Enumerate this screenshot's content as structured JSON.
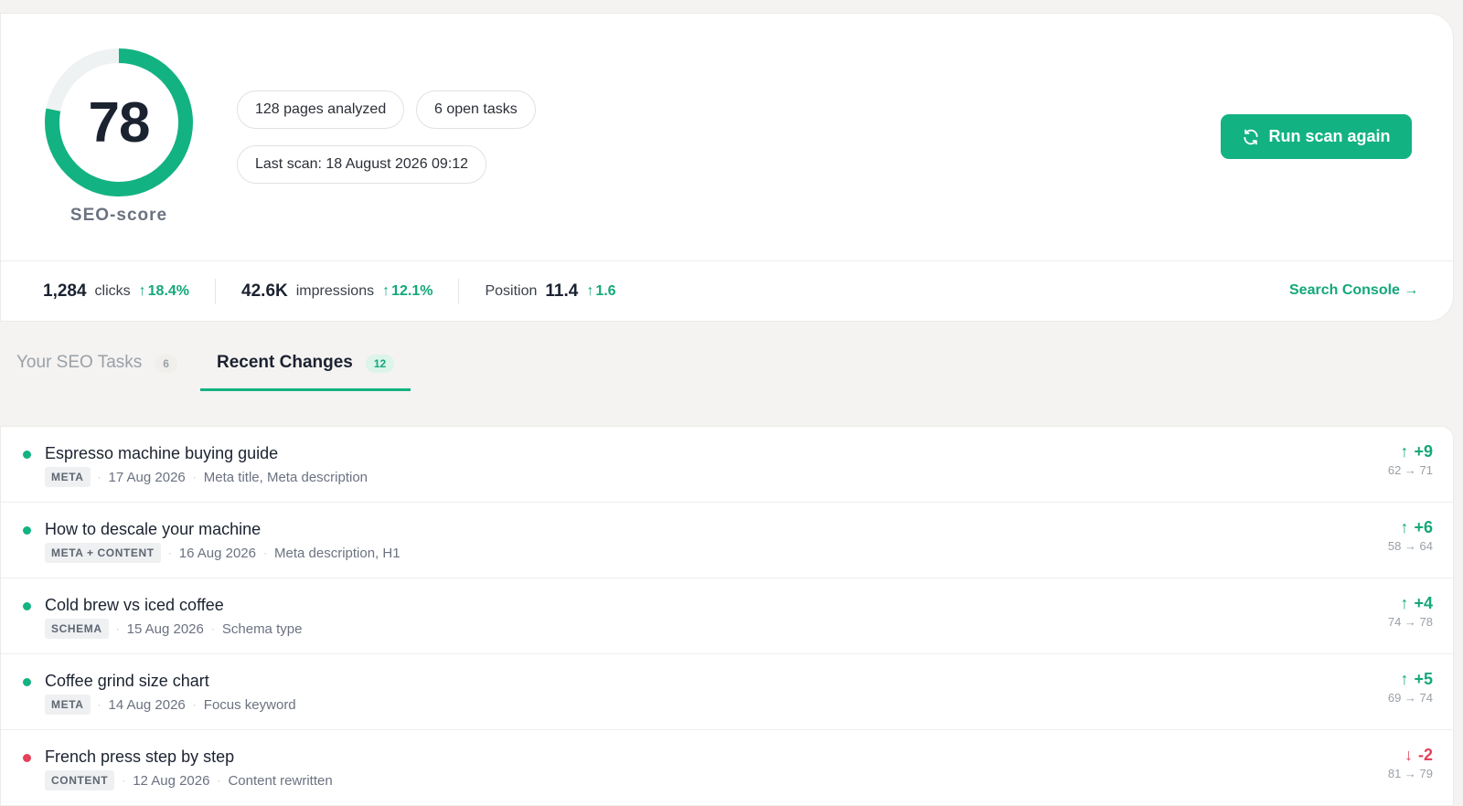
{
  "score": {
    "value": "78",
    "label": "SEO-score",
    "fraction": 0.78,
    "ring_color": "#13b282",
    "track_color": "#eef2f3"
  },
  "chips": {
    "pages": "128 pages analyzed",
    "tasks": "6 open tasks",
    "last_scan": "Last scan: 18 August 2026 09:12"
  },
  "run_button": {
    "label": "Run scan again",
    "icon": "refresh-icon"
  },
  "metrics": {
    "clicks": {
      "value": "1,284",
      "label": "clicks",
      "delta": "18.4%"
    },
    "impressions": {
      "value": "42.6K",
      "label": "impressions",
      "delta": "12.1%"
    },
    "position": {
      "label": "Position",
      "value": "11.4",
      "delta": "1.6"
    }
  },
  "search_console_link": "Search Console →",
  "tabs": [
    {
      "label": "Your SEO Tasks",
      "count": "6",
      "active": false
    },
    {
      "label": "Recent Changes",
      "count": "12",
      "active": true
    }
  ],
  "changes": [
    {
      "title": "Espresso machine buying guide",
      "tag": "META",
      "date": "17 Aug 2026",
      "fields": "Meta title, Meta description",
      "delta": "+9",
      "range": "62 → 71",
      "trend": "up"
    },
    {
      "title": "How to descale your machine",
      "tag": "META + CONTENT",
      "date": "16 Aug 2026",
      "fields": "Meta description, H1",
      "delta": "+6",
      "range": "58 → 64",
      "trend": "up"
    },
    {
      "title": "Cold brew vs iced coffee",
      "tag": "SCHEMA",
      "date": "15 Aug 2026",
      "fields": "Schema type",
      "delta": "+4",
      "range": "74 → 78",
      "trend": "up"
    },
    {
      "title": "Coffee grind size chart",
      "tag": "META",
      "date": "14 Aug 2026",
      "fields": "Focus keyword",
      "delta": "+5",
      "range": "69 → 74",
      "trend": "up"
    },
    {
      "title": "French press step by step",
      "tag": "CONTENT",
      "date": "12 Aug 2026",
      "fields": "Content rewritten",
      "delta": "-2",
      "range": "81 → 79",
      "trend": "down"
    }
  ],
  "colors": {
    "accent": "#13b282",
    "up": "#13a87a",
    "down": "#e5415a"
  }
}
